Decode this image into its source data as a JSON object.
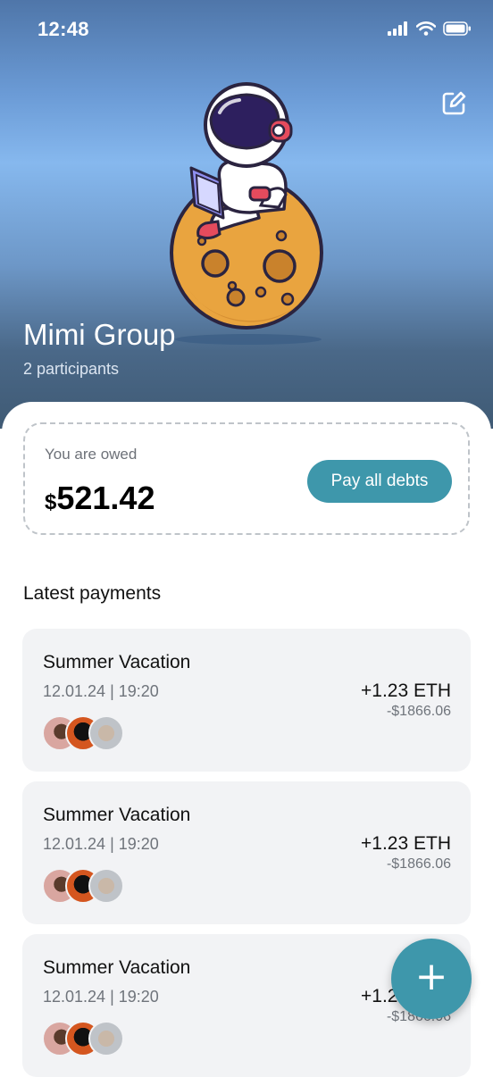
{
  "status_bar": {
    "time": "12:48"
  },
  "group": {
    "name": "Mimi Group",
    "participants": "2 participants"
  },
  "balance": {
    "label": "You are owed",
    "currency": "$",
    "amount": "521.42",
    "pay_button": "Pay all debts"
  },
  "payments_section": {
    "title": "Latest payments",
    "items": [
      {
        "title": "Summer Vacation",
        "date": "12.01.24 | 19:20",
        "crypto": "+1.23 ETH",
        "fiat": "-$1866.06"
      },
      {
        "title": "Summer Vacation",
        "date": "12.01.24 | 19:20",
        "crypto": "+1.23 ETH",
        "fiat": "-$1866.06"
      },
      {
        "title": "Summer Vacation",
        "date": "12.01.24 | 19:20",
        "crypto": "+1.23 ETH",
        "fiat": "-$1866.06"
      }
    ]
  },
  "fab": {
    "label": "+"
  },
  "colors": {
    "accent": "#3e97ab",
    "card_bg": "#f2f3f5",
    "moon": "#e9a43f",
    "hero_top": "#4f76a9",
    "hero_mid": "#86b8ee"
  },
  "icons": {
    "edit": "edit-icon",
    "signal": "signal-icon",
    "wifi": "wifi-icon",
    "battery": "battery-icon"
  }
}
